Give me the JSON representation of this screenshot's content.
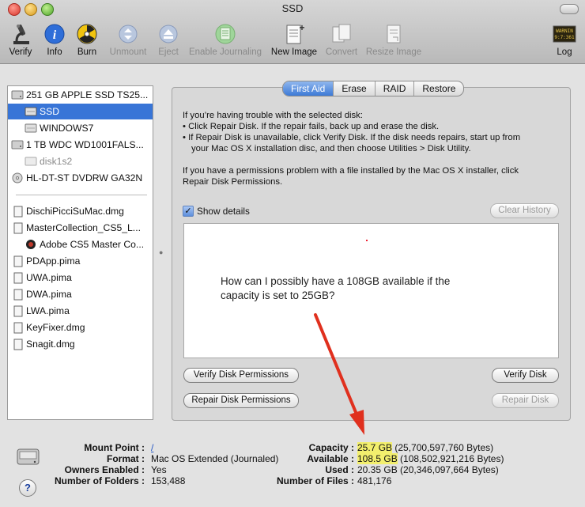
{
  "window": {
    "title": "SSD"
  },
  "toolbar": {
    "verify": "Verify",
    "info": "Info",
    "burn": "Burn",
    "unmount": "Unmount",
    "eject": "Eject",
    "enable_journaling": "Enable Journaling",
    "new_image": "New Image",
    "convert": "Convert",
    "resize_image": "Resize Image",
    "log": "Log",
    "log_icon_text": "WARNIN\n9:7:361"
  },
  "sidebar": {
    "items": [
      {
        "label": "251 GB APPLE SSD TS25..."
      },
      {
        "label": "SSD"
      },
      {
        "label": "WINDOWS7"
      },
      {
        "label": "1 TB WDC WD1001FALS..."
      },
      {
        "label": "disk1s2"
      },
      {
        "label": "HL-DT-ST DVDRW GA32N"
      },
      {
        "label": "DischiPicciSuMac.dmg"
      },
      {
        "label": "MasterCollection_CS5_L..."
      },
      {
        "label": "Adobe CS5 Master Co..."
      },
      {
        "label": "PDApp.pima"
      },
      {
        "label": "UWA.pima"
      },
      {
        "label": "DWA.pima"
      },
      {
        "label": "LWA.pima"
      },
      {
        "label": "KeyFixer.dmg"
      },
      {
        "label": "Snagit.dmg"
      }
    ]
  },
  "tabs": [
    "First Aid",
    "Erase",
    "RAID",
    "Restore"
  ],
  "first_aid": {
    "intro": "If you’re having trouble with the selected disk:",
    "bullet1": "• Click Repair Disk. If the repair fails, back up and erase the disk.",
    "bullet2a": "• If Repair Disk is unavailable, click Verify Disk. If the disk needs repairs, start up from",
    "bullet2b": "your Mac OS X installation disc, and then choose Utilities > Disk Utility.",
    "perm1": "If you have a permissions problem with a file installed by the Mac OS X installer, click",
    "perm2": "Repair Disk Permissions.",
    "show_details": "Show details",
    "clear_history": "Clear History",
    "verify_perm": "Verify Disk Permissions",
    "verify_disk": "Verify Disk",
    "repair_perm": "Repair Disk Permissions",
    "repair_disk": "Repair Disk",
    "annotation": "How can I possibly have a 108GB available if the capacity is set to 25GB?"
  },
  "info": {
    "mount_point_label": "Mount Point :",
    "mount_point": "/",
    "format_label": "Format :",
    "format": "Mac OS Extended (Journaled)",
    "owners_label": "Owners Enabled :",
    "owners": "Yes",
    "folders_label": "Number of Folders :",
    "folders": "153,488",
    "capacity_label": "Capacity :",
    "capacity_hl": "25.7 GB",
    "capacity_rest": " (25,700,597,760 Bytes)",
    "available_label": "Available :",
    "available_hl": "108.5 GB",
    "available_rest": " (108,502,921,216 Bytes)",
    "used_label": "Used :",
    "used": "20.35 GB (20,346,097,664 Bytes)",
    "files_label": "Number of Files :",
    "files": "481,176",
    "help": "?"
  },
  "colors": {
    "selection": "#3875d7",
    "highlight": "#f3ef6e",
    "arrow": "#e0301e"
  }
}
